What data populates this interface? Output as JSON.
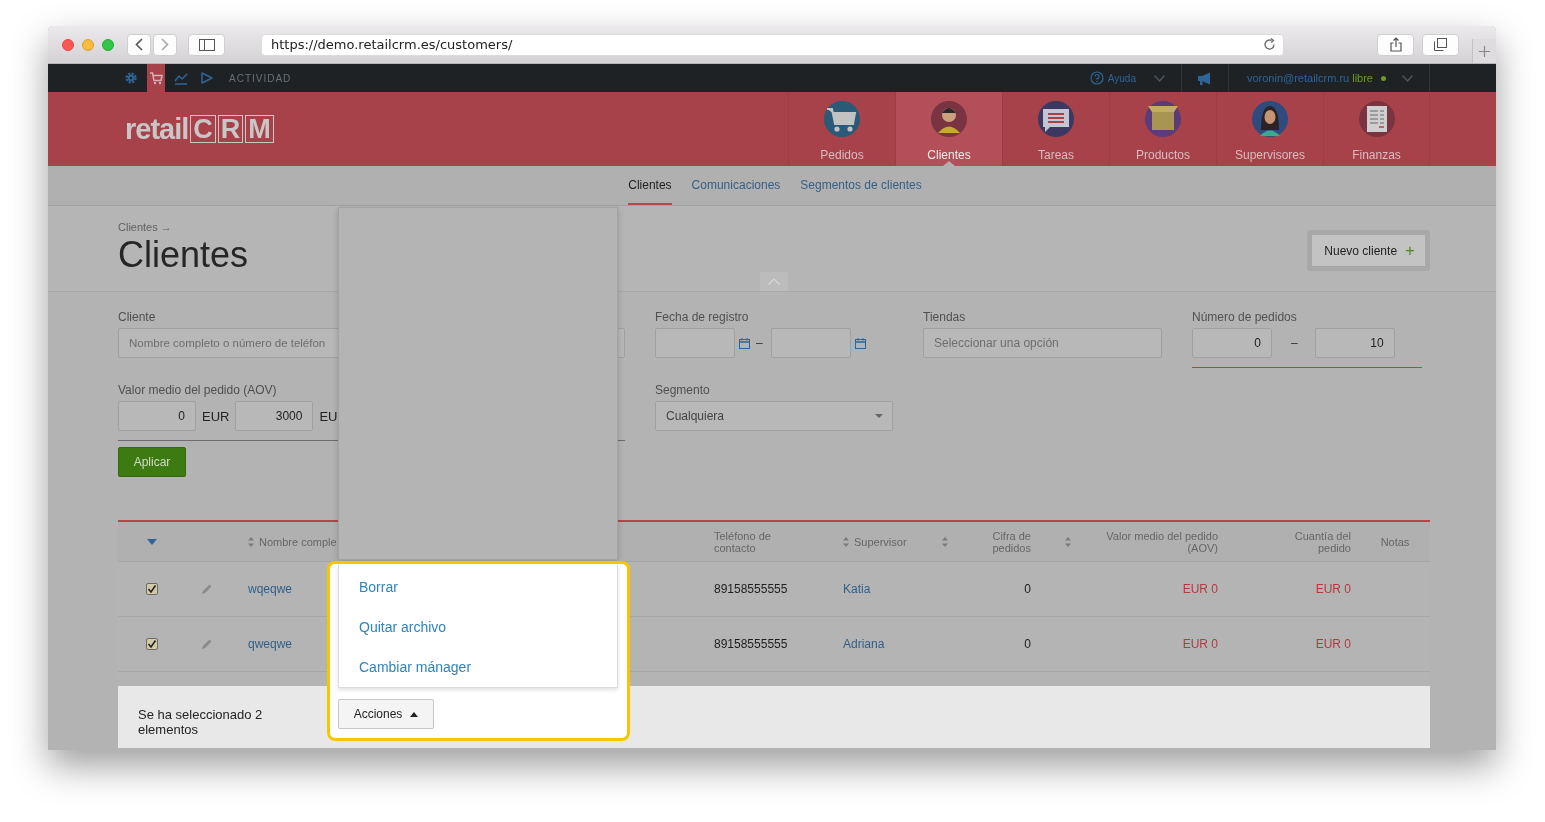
{
  "browser": {
    "url": "https://demo.retailcrm.es/customers/"
  },
  "topbar": {
    "tools": [
      {
        "kind": "settings",
        "selected": false
      },
      {
        "kind": "cart",
        "selected": true
      },
      {
        "kind": "chart",
        "selected": false
      },
      {
        "kind": "play",
        "selected": false
      }
    ],
    "section": "ACTIVIDAD",
    "help": "Ayuda",
    "user": "voronin@retailcrm.ru",
    "plan": "libre"
  },
  "logo": {
    "word": "retail",
    "letters": [
      "C",
      "R",
      "M"
    ]
  },
  "modules": [
    {
      "label": "Pedidos",
      "kind": "cart",
      "selected": false
    },
    {
      "label": "Clientes",
      "kind": "person",
      "selected": true
    },
    {
      "label": "Tareas",
      "kind": "list",
      "selected": false
    },
    {
      "label": "Productos",
      "kind": "box",
      "selected": false
    },
    {
      "label": "Supervisores",
      "kind": "person_alt",
      "selected": false
    },
    {
      "label": "Finanzas",
      "kind": "document",
      "selected": false
    }
  ],
  "subnav": [
    {
      "label": "Clientes",
      "selected": true
    },
    {
      "label": "Comunicaciones",
      "selected": false
    },
    {
      "label": "Segmentos de clientes",
      "selected": false
    }
  ],
  "page": {
    "breadcrumb": "Clientes →",
    "title": "Clientes",
    "new_button": "Nuevo cliente",
    "new_button_icon": "+"
  },
  "filters": {
    "client": {
      "label": "Cliente",
      "placeholder": "Nombre completo o número de teléfon"
    },
    "aov": {
      "label": "Valor medio del pedido (AOV)",
      "min": "0",
      "currency": "EUR",
      "max": "3000",
      "currency_2": "EU"
    },
    "registered": {
      "label": "Fecha de registro",
      "separator": "–"
    },
    "stores": {
      "label": "Tiendas",
      "placeholder": "Seleccionar una opción"
    },
    "orders": {
      "label": "Número de pedidos",
      "min": "0",
      "separator": "–",
      "max": "10"
    },
    "segment": {
      "label": "Segmento",
      "value": "Cualquiera"
    },
    "apply": "Aplicar"
  },
  "table": {
    "columns": [
      {
        "label": "Nombre comple",
        "sortable": true,
        "kind": "link"
      },
      {
        "label": "Teléfono de contacto",
        "sortable": false,
        "kind": "plain"
      },
      {
        "label": "Supervisor",
        "sortable": true,
        "kind": "link"
      },
      {
        "label": "Cifra de pedidos",
        "sortable": true,
        "kind": "plain"
      },
      {
        "label": "Valor medio del pedido (AOV)",
        "sortable": true,
        "kind": "money"
      },
      {
        "label": "Cuantía del pedido",
        "sortable": false,
        "kind": "money"
      },
      {
        "label": "Notas",
        "sortable": false
      }
    ],
    "rows": [
      {
        "selected": true,
        "cells": [
          "wqeqwe",
          "89158555555",
          "Katia",
          "0",
          "EUR 0",
          "EUR 0"
        ]
      },
      {
        "selected": true,
        "cells": [
          "qweqwe",
          "89158555555",
          "Adriana",
          "0",
          "EUR 0",
          "EUR 0"
        ]
      }
    ]
  },
  "selection": {
    "text": "Se ha seleccionado 2 elementos",
    "actions_button": "Acciones",
    "menu": [
      "Borrar",
      "Quitar archivo",
      "Cambiar mánager"
    ]
  }
}
